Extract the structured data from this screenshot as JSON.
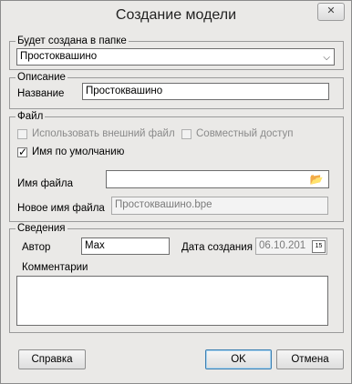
{
  "window": {
    "title": "Создание модели",
    "close_glyph": "✕"
  },
  "folder_group": {
    "label": "Будет создана  в папке",
    "selected": "Простоквашино"
  },
  "description_group": {
    "label": "Описание",
    "name_label": "Название",
    "name_value": "Простоквашино"
  },
  "file_group": {
    "label": "Файл",
    "use_external_label": "Использовать внешний файл",
    "use_external_checked": false,
    "shared_access_label": "Совместный доступ",
    "shared_access_checked": false,
    "default_name_label": "Имя по умолчанию",
    "default_name_checked": true,
    "file_name_label": "Имя файла",
    "file_name_value": "",
    "new_file_name_label": "Новое имя файла",
    "new_file_name_value": "Простоквашино.bpe"
  },
  "info_group": {
    "label": "Сведения",
    "author_label": "Автор",
    "author_value": "Max",
    "created_label": "Дата создания",
    "created_value": "06.10.201",
    "calendar_glyph": "15",
    "comments_label": "Комментарии",
    "comments_value": ""
  },
  "buttons": {
    "help": "Справка",
    "ok": "OK",
    "cancel": "Отмена"
  }
}
